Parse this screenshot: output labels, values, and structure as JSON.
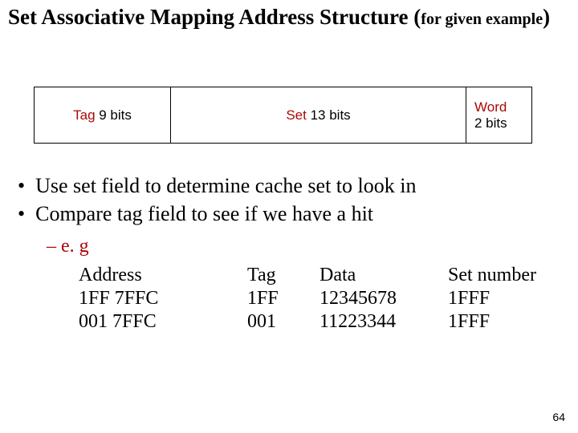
{
  "title": {
    "main": "Set Associative Mapping Address Structure ",
    "paren_open": "(",
    "sub": "for given example",
    "paren_close": ")"
  },
  "address_fields": {
    "tag": {
      "label": "Tag",
      "bits": " 9 bits"
    },
    "set": {
      "label": "Set",
      "bits": "  13 bits"
    },
    "word": {
      "label": "Word",
      "bits": "2 bits"
    }
  },
  "bullets": {
    "b1": "Use set field to determine cache set to look in",
    "b2": "Compare tag field to see if we have a hit"
  },
  "example": {
    "heading": "e. g",
    "headers": {
      "address": "Address",
      "tag": "Tag",
      "data": "Data",
      "set": "Set number"
    },
    "rows": [
      {
        "address": "1FF 7FFC",
        "tag": "1FF",
        "data": "12345678",
        "set": "1FFF"
      },
      {
        "address": "001 7FFC",
        "tag": "001",
        "data": "11223344",
        "set": "1FFF"
      }
    ]
  },
  "page_number": "64"
}
